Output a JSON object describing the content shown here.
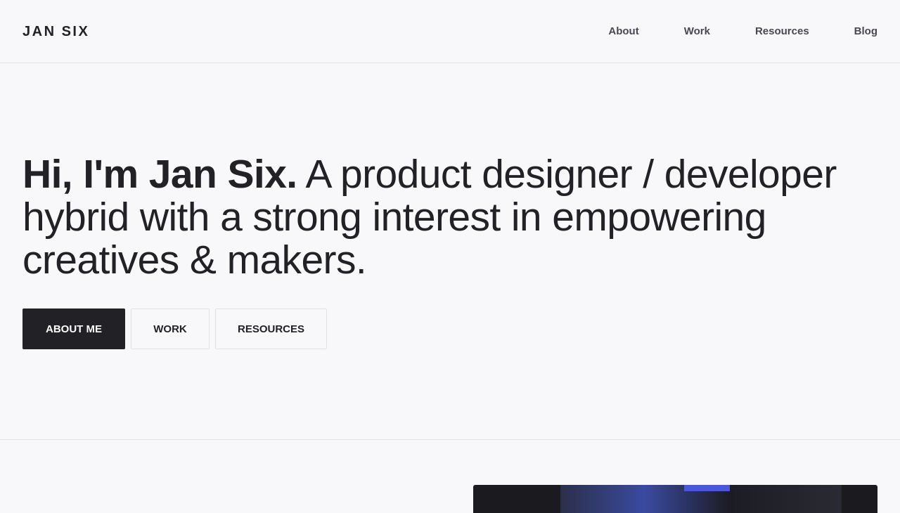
{
  "header": {
    "logo": "JAN SIX",
    "nav": [
      "About",
      "Work",
      "Resources",
      "Blog"
    ]
  },
  "hero": {
    "bold": "Hi, I'm Jan Six.",
    "rest": " A product designer / developer hybrid with a strong interest in empowering creatives & makers."
  },
  "buttons": {
    "about": "ABOUT ME",
    "work": "WORK",
    "resources": "RESOURCES"
  },
  "colors": {
    "background": "#f8f7f9",
    "text": "#222126",
    "primary_button": "#222126",
    "border": "#e2e0e5"
  }
}
